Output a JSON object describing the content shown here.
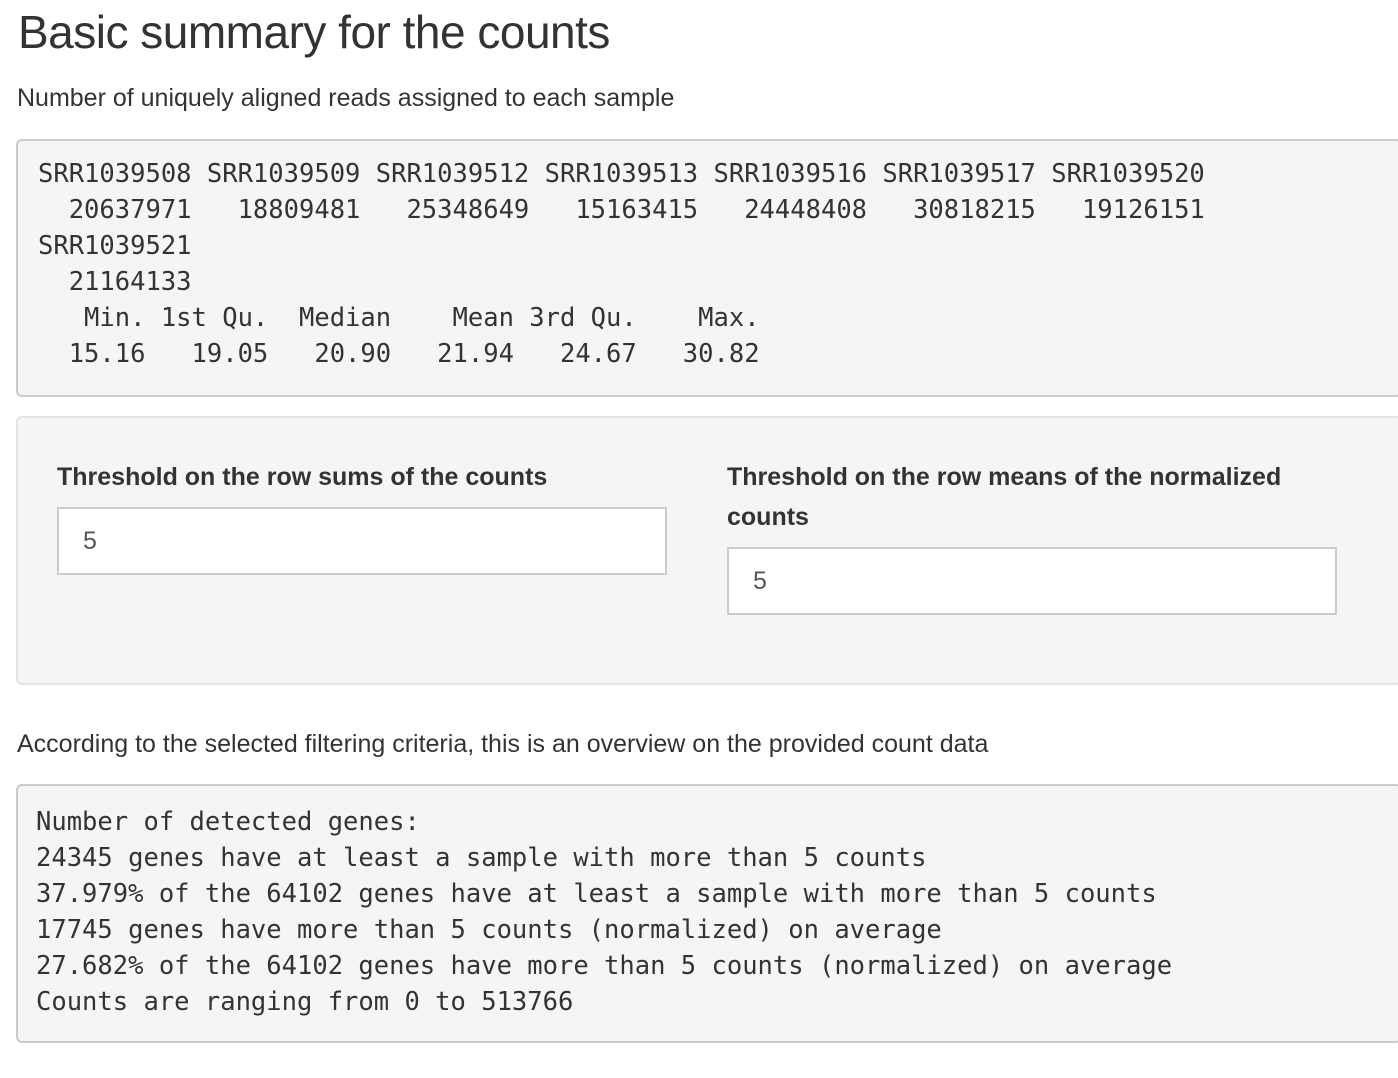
{
  "title": "Basic summary for the counts",
  "reads_caption": "Number of uniquely aligned reads assigned to each sample",
  "reads_output": [
    "SRR1039508 SRR1039509 SRR1039512 SRR1039513 SRR1039516 SRR1039517 SRR1039520",
    "  20637971   18809481   25348649   15163415   24448408   30818215   19126151",
    "SRR1039521",
    "  21164133",
    "   Min. 1st Qu.  Median    Mean 3rd Qu.    Max.",
    "  15.16   19.05   20.90   21.94   24.67   30.82"
  ],
  "filters": {
    "rowsums": {
      "label": "Threshold on the row sums of the counts",
      "value": "5"
    },
    "rowmeans": {
      "label": "Threshold on the row means of the normalized counts",
      "value": "5"
    }
  },
  "overview_caption": "According to the selected filtering criteria, this is an overview on the provided count data",
  "overview_output": [
    "Number of detected genes:",
    "24345 genes have at least a sample with more than 5 counts",
    "37.979% of the 64102 genes have at least a sample with more than 5 counts",
    "17745 genes have more than 5 counts (normalized) on average",
    "27.682% of the 64102 genes have more than 5 counts (normalized) on average",
    "Counts are ranging from 0 to 513766"
  ]
}
